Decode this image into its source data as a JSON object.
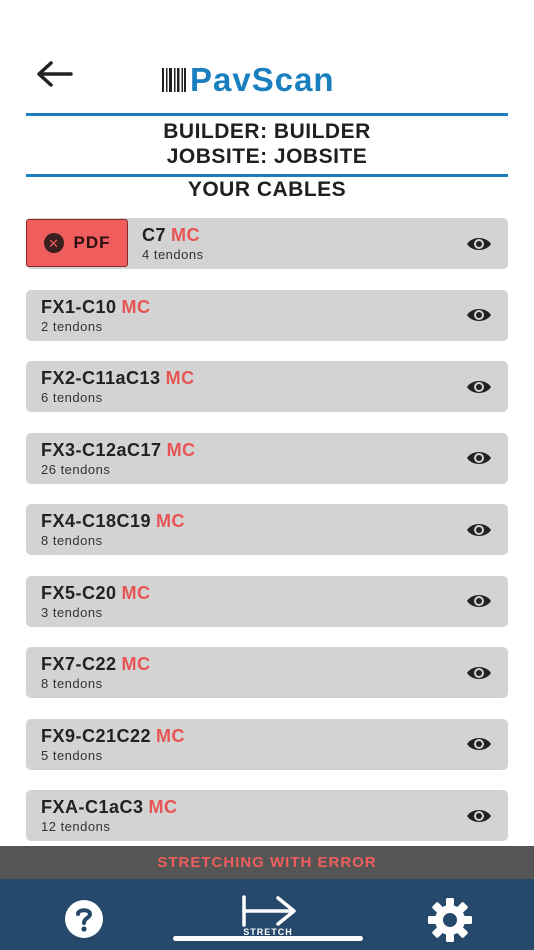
{
  "app": {
    "logo_text": "PavScan"
  },
  "header": {
    "builder": "BUILDER: BUILDER",
    "jobsite": "JOBSITE: JOBSITE",
    "section_title": "YOUR CABLES"
  },
  "cables": [
    {
      "name": "C7",
      "tag": "MC",
      "tendons": "4 tendons",
      "pdf_label": "PDF"
    },
    {
      "name": "FX1-C10",
      "tag": "MC",
      "tendons": "2 tendons"
    },
    {
      "name": "FX2-C11aC13",
      "tag": "MC",
      "tendons": "6 tendons"
    },
    {
      "name": "FX3-C12aC17",
      "tag": "MC",
      "tendons": "26 tendons"
    },
    {
      "name": "FX4-C18C19",
      "tag": "MC",
      "tendons": "8 tendons"
    },
    {
      "name": "FX5-C20",
      "tag": "MC",
      "tendons": "3 tendons"
    },
    {
      "name": "FX7-C22",
      "tag": "MC",
      "tendons": "8 tendons"
    },
    {
      "name": "FX9-C21C22",
      "tag": "MC",
      "tendons": "5 tendons"
    },
    {
      "name": "FXA-C1aC3",
      "tag": "MC",
      "tendons": "12 tendons"
    }
  ],
  "status": {
    "text": "STRETCHING WITH ERROR"
  },
  "nav": {
    "stretch_label": "STRETCH"
  },
  "colors": {
    "brand_blue": "#1a7fbf",
    "accent_red": "#ef5d5d",
    "nav_bg": "#26496b",
    "row_bg": "#d3d3d3"
  }
}
